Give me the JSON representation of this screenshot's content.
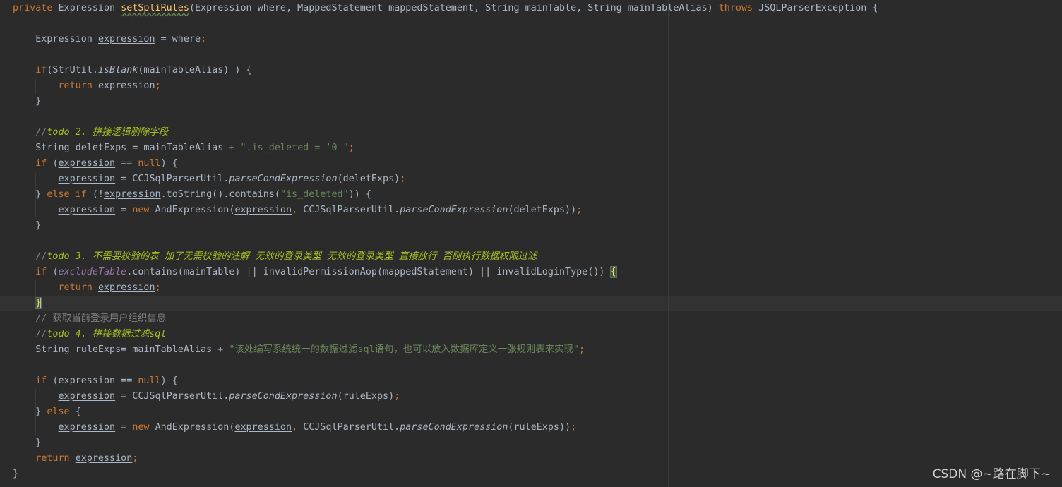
{
  "editor": {
    "theme": "darcula",
    "colors": {
      "background": "#2b2b2b",
      "keyword": "#cc7832",
      "method": "#ffc66d",
      "string": "#6a8759",
      "comment": "#808080",
      "todo": "#a8c023",
      "field": "#9876aa",
      "text": "#a9b7c6"
    },
    "caret_line": 20
  },
  "code_lines": [
    [
      {
        "t": "private ",
        "c": "kw"
      },
      {
        "t": "Expression "
      },
      {
        "t": "setSpliRules",
        "c": "fn wavy"
      },
      {
        "t": "(Expression where, MappedStatement mappedStatement, String mainTable, String mainTableAlias) "
      },
      {
        "t": "throws ",
        "c": "kw"
      },
      {
        "t": "JSQLParserException {"
      }
    ],
    [],
    [
      {
        "t": "    Expression "
      },
      {
        "t": "expression",
        "c": "und"
      },
      {
        "t": " = where"
      },
      {
        "t": ";",
        "c": "kw"
      }
    ],
    [],
    [
      {
        "t": "    "
      },
      {
        "t": "if",
        "c": "kw"
      },
      {
        "t": "(StrUtil."
      },
      {
        "t": "isBlank",
        "c": "it"
      },
      {
        "t": "(mainTableAlias) ) {"
      }
    ],
    [
      {
        "t": "        "
      },
      {
        "t": "return ",
        "c": "kw"
      },
      {
        "t": "expression",
        "c": "und"
      },
      {
        "t": ";",
        "c": "kw"
      }
    ],
    [
      {
        "t": "    }"
      }
    ],
    [],
    [
      {
        "t": "    "
      },
      {
        "t": "//",
        "c": "cmt"
      },
      {
        "t": "todo 2. 拼接逻辑删除字段",
        "c": "todo"
      }
    ],
    [
      {
        "t": "    String "
      },
      {
        "t": "deletExps",
        "c": "und"
      },
      {
        "t": " = mainTableAlias + "
      },
      {
        "t": "\".is_deleted = '0'\"",
        "c": "str"
      },
      {
        "t": ";",
        "c": "kw"
      }
    ],
    [
      {
        "t": "    "
      },
      {
        "t": "if ",
        "c": "kw"
      },
      {
        "t": "("
      },
      {
        "t": "expression",
        "c": "und"
      },
      {
        "t": " == "
      },
      {
        "t": "null",
        "c": "kw"
      },
      {
        "t": ") {"
      }
    ],
    [
      {
        "t": "        "
      },
      {
        "t": "expression",
        "c": "und"
      },
      {
        "t": " = CCJSqlParserUtil."
      },
      {
        "t": "parseCondExpression",
        "c": "it"
      },
      {
        "t": "(deletExps)"
      },
      {
        "t": ";",
        "c": "kw"
      }
    ],
    [
      {
        "t": "    } "
      },
      {
        "t": "else if ",
        "c": "kw"
      },
      {
        "t": "(!"
      },
      {
        "t": "expression",
        "c": "und"
      },
      {
        "t": ".toString().contains("
      },
      {
        "t": "\"is_deleted\"",
        "c": "str"
      },
      {
        "t": ")) {"
      }
    ],
    [
      {
        "t": "        "
      },
      {
        "t": "expression",
        "c": "und"
      },
      {
        "t": " = "
      },
      {
        "t": "new ",
        "c": "kw"
      },
      {
        "t": "AndExpression("
      },
      {
        "t": "expression",
        "c": "und"
      },
      {
        "t": ", ",
        "c": "kw"
      },
      {
        "t": "CCJSqlParserUtil."
      },
      {
        "t": "parseCondExpression",
        "c": "it"
      },
      {
        "t": "(deletExps))"
      },
      {
        "t": ";",
        "c": "kw"
      }
    ],
    [
      {
        "t": "    }"
      }
    ],
    [],
    [
      {
        "t": "    "
      },
      {
        "t": "//",
        "c": "cmt"
      },
      {
        "t": "todo 3. 不需要校验的表 加了无需校验的注解 无效的登录类型 无效的登录类型 直接放行 否则执行数据权限过滤",
        "c": "todo"
      }
    ],
    [
      {
        "t": "    "
      },
      {
        "t": "if ",
        "c": "kw"
      },
      {
        "t": "("
      },
      {
        "t": "excludeTable",
        "c": "fld"
      },
      {
        "t": ".contains(mainTable) || invalidPermissionAop(mappedStatement) || invalidLoginType()) "
      },
      {
        "t": "{",
        "c": "brace-hl"
      }
    ],
    [
      {
        "t": "        "
      },
      {
        "t": "return ",
        "c": "kw"
      },
      {
        "t": "expression",
        "c": "und"
      },
      {
        "t": ";",
        "c": "kw"
      }
    ],
    [
      {
        "t": "    "
      },
      {
        "t": "}",
        "c": "brace-hl"
      },
      {
        "t": "",
        "c": "caret"
      }
    ],
    [
      {
        "t": "    "
      },
      {
        "t": "// 获取当前登录用户组织信息",
        "c": "cmt"
      }
    ],
    [
      {
        "t": "    "
      },
      {
        "t": "//",
        "c": "cmt"
      },
      {
        "t": "todo 4. 拼接数据过滤sql",
        "c": "todo"
      }
    ],
    [
      {
        "t": "    String ruleExps= mainTableAlias + "
      },
      {
        "t": "\"该处编写系统统一的数据过滤sql语句，也可以放入数据库定义一张规则表来实现\"",
        "c": "str"
      },
      {
        "t": ";",
        "c": "kw"
      }
    ],
    [],
    [
      {
        "t": "    "
      },
      {
        "t": "if ",
        "c": "kw"
      },
      {
        "t": "("
      },
      {
        "t": "expression",
        "c": "und"
      },
      {
        "t": " == "
      },
      {
        "t": "null",
        "c": "kw"
      },
      {
        "t": ") {"
      }
    ],
    [
      {
        "t": "        "
      },
      {
        "t": "expression",
        "c": "und"
      },
      {
        "t": " = CCJSqlParserUtil."
      },
      {
        "t": "parseCondExpression",
        "c": "it"
      },
      {
        "t": "(ruleExps)"
      },
      {
        "t": ";",
        "c": "kw"
      }
    ],
    [
      {
        "t": "    } "
      },
      {
        "t": "else ",
        "c": "kw"
      },
      {
        "t": "{"
      }
    ],
    [
      {
        "t": "        "
      },
      {
        "t": "expression",
        "c": "und"
      },
      {
        "t": " = "
      },
      {
        "t": "new ",
        "c": "kw"
      },
      {
        "t": "AndExpression("
      },
      {
        "t": "expression",
        "c": "und"
      },
      {
        "t": ", ",
        "c": "kw"
      },
      {
        "t": "CCJSqlParserUtil."
      },
      {
        "t": "parseCondExpression",
        "c": "it"
      },
      {
        "t": "(ruleExps))"
      },
      {
        "t": ";",
        "c": "kw"
      }
    ],
    [
      {
        "t": "    }"
      }
    ],
    [
      {
        "t": "    "
      },
      {
        "t": "return ",
        "c": "kw"
      },
      {
        "t": "expression",
        "c": "und"
      },
      {
        "t": ";",
        "c": "kw"
      }
    ],
    [
      {
        "t": "}"
      }
    ]
  ],
  "watermark": "CSDN @~路在脚下~"
}
